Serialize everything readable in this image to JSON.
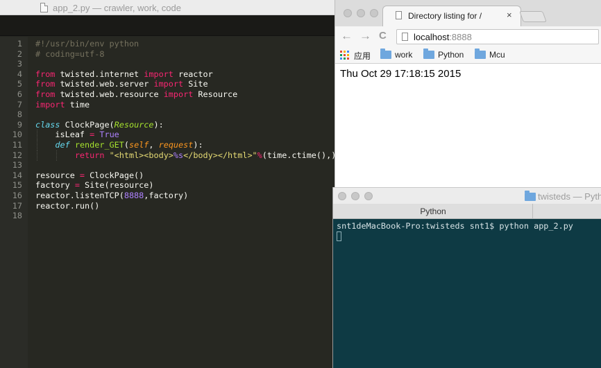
{
  "editor": {
    "window_title": "app_2.py — crawler, work, code",
    "code_lines": [
      {
        "n": "1",
        "parts": [
          {
            "t": "#!/usr/bin/env python",
            "c": "cm"
          }
        ]
      },
      {
        "n": "2",
        "parts": [
          {
            "t": "# coding=utf-8",
            "c": "cm"
          }
        ]
      },
      {
        "n": "3",
        "parts": []
      },
      {
        "n": "4",
        "parts": [
          {
            "t": "from",
            "c": "kw"
          },
          {
            "t": " twisted.internet ",
            "c": ""
          },
          {
            "t": "import",
            "c": "kw"
          },
          {
            "t": " reactor",
            "c": ""
          }
        ]
      },
      {
        "n": "5",
        "parts": [
          {
            "t": "from",
            "c": "kw"
          },
          {
            "t": " twisted.web.server ",
            "c": ""
          },
          {
            "t": "import",
            "c": "kw"
          },
          {
            "t": " Site",
            "c": ""
          }
        ]
      },
      {
        "n": "6",
        "parts": [
          {
            "t": "from",
            "c": "kw"
          },
          {
            "t": " twisted.web.resource ",
            "c": ""
          },
          {
            "t": "import",
            "c": "kw"
          },
          {
            "t": " Resource",
            "c": ""
          }
        ]
      },
      {
        "n": "7",
        "parts": [
          {
            "t": "import",
            "c": "kw"
          },
          {
            "t": " time",
            "c": ""
          }
        ]
      },
      {
        "n": "8",
        "parts": []
      },
      {
        "n": "9",
        "parts": [
          {
            "t": "class",
            "c": "df"
          },
          {
            "t": " ",
            "c": ""
          },
          {
            "t": "ClockPage",
            "c": ""
          },
          {
            "t": "(",
            "c": ""
          },
          {
            "t": "Resource",
            "c": "cl"
          },
          {
            "t": "):",
            "c": ""
          }
        ]
      },
      {
        "n": "10",
        "parts": [
          {
            "t": "    isLeaf ",
            "c": ""
          },
          {
            "t": "=",
            "c": "kw"
          },
          {
            "t": " ",
            "c": ""
          },
          {
            "t": "True",
            "c": "nm"
          }
        ]
      },
      {
        "n": "11",
        "parts": [
          {
            "t": "    ",
            "c": ""
          },
          {
            "t": "def",
            "c": "df"
          },
          {
            "t": " ",
            "c": ""
          },
          {
            "t": "render_GET",
            "c": "fn"
          },
          {
            "t": "(",
            "c": ""
          },
          {
            "t": "self",
            "c": "pm"
          },
          {
            "t": ", ",
            "c": ""
          },
          {
            "t": "request",
            "c": "pm"
          },
          {
            "t": "):",
            "c": ""
          }
        ]
      },
      {
        "n": "12",
        "parts": [
          {
            "t": "        ",
            "c": ""
          },
          {
            "t": "return",
            "c": "kw"
          },
          {
            "t": " ",
            "c": ""
          },
          {
            "t": "\"<html><body>",
            "c": "st"
          },
          {
            "t": "%s",
            "c": "nm"
          },
          {
            "t": "</body></html>\"",
            "c": "st"
          },
          {
            "t": "%",
            "c": "kw"
          },
          {
            "t": "(time.ctime(),)",
            "c": ""
          }
        ]
      },
      {
        "n": "13",
        "parts": []
      },
      {
        "n": "14",
        "parts": [
          {
            "t": "resource ",
            "c": ""
          },
          {
            "t": "=",
            "c": "kw"
          },
          {
            "t": " ClockPage()",
            "c": ""
          }
        ]
      },
      {
        "n": "15",
        "parts": [
          {
            "t": "factory ",
            "c": ""
          },
          {
            "t": "=",
            "c": "kw"
          },
          {
            "t": " Site(resource)",
            "c": ""
          }
        ]
      },
      {
        "n": "16",
        "parts": [
          {
            "t": "reactor.listenTCP(",
            "c": ""
          },
          {
            "t": "8888",
            "c": "nm"
          },
          {
            "t": ",factory)",
            "c": ""
          }
        ]
      },
      {
        "n": "17",
        "parts": [
          {
            "t": "reactor.run()",
            "c": ""
          }
        ]
      },
      {
        "n": "18",
        "parts": []
      }
    ]
  },
  "browser": {
    "tab_title": "Directory listing for /",
    "tab_close": "×",
    "nav_back": "←",
    "nav_forward": "→",
    "nav_reload": "C",
    "url_host": "localhost",
    "url_port": ":8888",
    "bookmarks": [
      "应用",
      "work",
      "Python",
      "Mcu"
    ],
    "page_text": "Thu Oct 29 17:18:15 2015"
  },
  "terminal": {
    "window_title": "twisteds — Pyth",
    "tab_label": "Python",
    "prompt_line": "snt1deMacBook-Pro:twisteds snt1$ python app_2.py"
  },
  "colors": {
    "editor_bg": "#272822",
    "keyword": "#f92672",
    "comment": "#75715e",
    "string": "#e6db74",
    "number": "#ae81ff",
    "function": "#a6e22e",
    "terminal_bg": "#0e3a44",
    "folder_icon": "#6fa7de"
  }
}
